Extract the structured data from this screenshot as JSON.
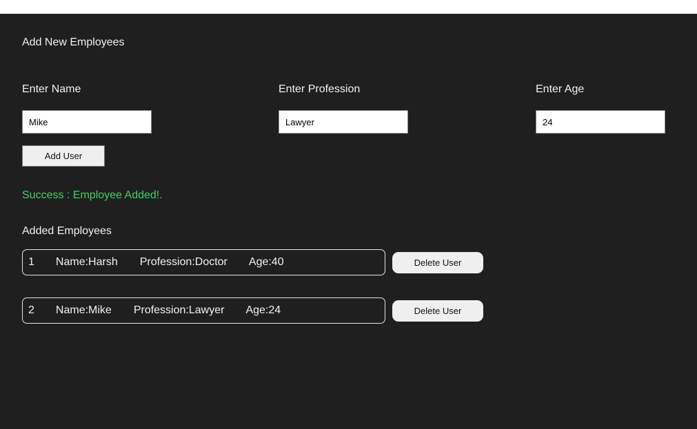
{
  "heading": "Add New Employees",
  "form": {
    "name_label": "Enter Name",
    "name_value": "Mike",
    "profession_label": "Enter Profession",
    "profession_value": "Lawyer",
    "age_label": "Enter Age",
    "age_value": "24",
    "add_button": "Add User"
  },
  "status": {
    "message": "Success : Employee Added!.",
    "color": "#3fd36a"
  },
  "employees_title": "Added Employees",
  "employees": [
    {
      "index": "1",
      "name": "Name:Harsh",
      "profession": "Profession:Doctor",
      "age": "Age:40",
      "delete_label": "Delete User"
    },
    {
      "index": "2",
      "name": "Name:Mike",
      "profession": "Profession:Lawyer",
      "age": "Age:24",
      "delete_label": "Delete User"
    }
  ],
  "colors": {
    "background": "#1f1f1f",
    "text": "#f2f2f2",
    "button": "#efefef"
  }
}
